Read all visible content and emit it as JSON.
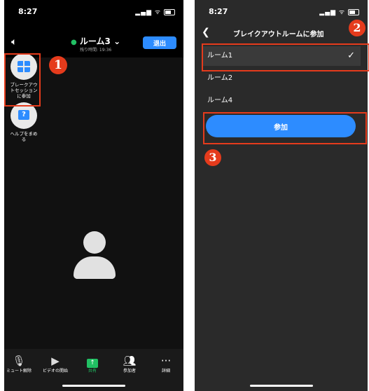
{
  "left_phone": {
    "status_time": "8:27",
    "room_name": "ルーム3",
    "remaining_time": "残り時間: 19:36",
    "leave_label": "退出",
    "breakout_label": "ブレークアウトセッションに参加",
    "help_label": "ヘルプをまめる",
    "toolbar": [
      {
        "label": "ミュート解除",
        "icon": "mic-off-icon"
      },
      {
        "label": "ビデオの開始",
        "icon": "video-off-icon"
      },
      {
        "label": "共有",
        "icon": "share-icon"
      },
      {
        "label": "参加者",
        "icon": "participants-icon"
      },
      {
        "label": "詳細",
        "icon": "more-icon"
      }
    ]
  },
  "right_phone": {
    "status_time": "8:27",
    "title": "ブレイクアウトルームに参加",
    "rooms": [
      "ルーム1",
      "ルーム2",
      "ルーム4"
    ],
    "join_label": "参加"
  },
  "annotations": {
    "step1": "❶",
    "step2": "❷",
    "step3": "❸"
  },
  "colors": {
    "accent_blue": "#2d8cff",
    "highlight_red": "#e53b1c",
    "secure_green": "#21c063"
  }
}
